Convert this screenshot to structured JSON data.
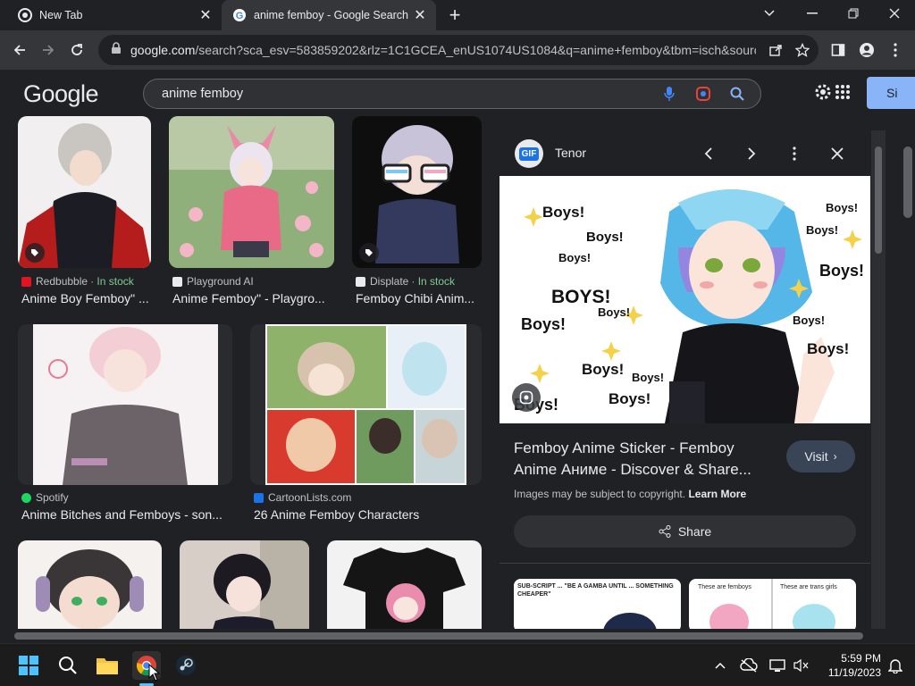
{
  "browser": {
    "tabs": [
      {
        "title": "New Tab",
        "active": false
      },
      {
        "title": "anime femboy - Google Search",
        "active": true
      }
    ],
    "url_host": "google.com",
    "url_rest": "/search?sca_esv=583859202&rlz=1C1GCEA_enUS1074US1084&q=anime+femboy&tbm=isch&sourc..."
  },
  "google": {
    "logo": "Google",
    "query": "anime femboy",
    "signin_label": "Si"
  },
  "results": [
    {
      "source": "Redbubble",
      "stock": "· In stock",
      "caption": "Anime Boy Femboy\" ..."
    },
    {
      "source": "Playground AI",
      "stock": "",
      "caption": "Anime Femboy\" - Playgro..."
    },
    {
      "source": "Displate",
      "stock": "· In stock",
      "caption": "Femboy Chibi Anim..."
    },
    {
      "source": "Spotify",
      "stock": "",
      "caption": "Anime Bitches and Femboys - son..."
    },
    {
      "source": "CartoonLists.com",
      "stock": "",
      "caption": "26 Anime Femboy Characters"
    }
  ],
  "panel": {
    "site": "Tenor",
    "logo_text": "GIF",
    "title": "Femboy Anime Sticker - Femboy Anime Аниме - Discover & Share...",
    "visit_label": "Visit",
    "copyright_text": "Images may be subject to copyright.",
    "learn_more": "Learn More",
    "share_label": "Share",
    "sticker_words": [
      "Boys!",
      "Boys!",
      "Boys!",
      "BOYS!",
      "Boys!",
      "Boys!",
      "Boys!",
      "Boys!",
      "Boys!",
      "Boys!",
      "Boys!",
      "Boys!",
      "Boys!",
      "Boys!",
      "Boys!"
    ],
    "related_1_text": "SUB-SCRIPT ... \"BE A GAMBA UNTIL ... SOMETHING CHEAPER\"",
    "related_2_left": "These are femboys",
    "related_2_right": "These are trans girls"
  },
  "taskbar": {
    "time": "5:59 PM",
    "date": "11/19/2023"
  },
  "colors": {
    "background": "#202124",
    "accent": "#8ab4f8",
    "in_stock": "#81c995"
  }
}
